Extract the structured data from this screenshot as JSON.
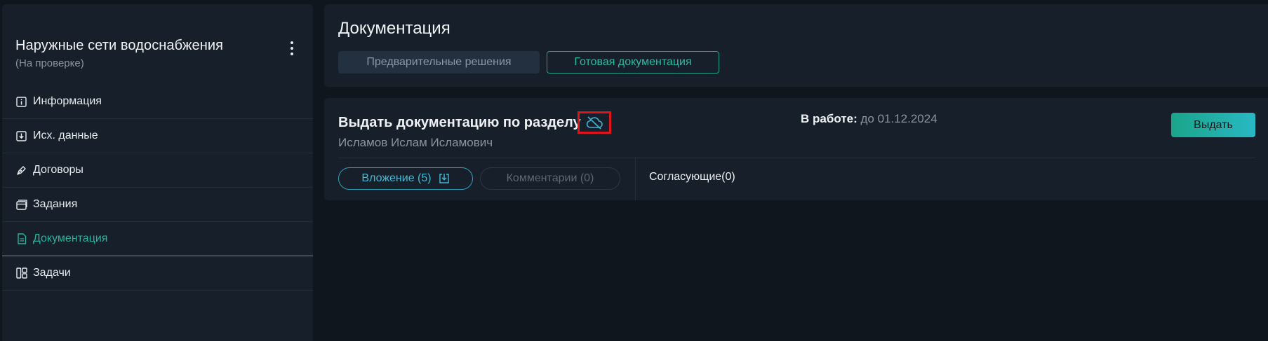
{
  "sidebar": {
    "project_title": "Наружные сети водоснабжения",
    "project_status": "(На проверке)",
    "items": [
      {
        "label": "Информация",
        "icon": "info-icon"
      },
      {
        "label": "Исх. данные",
        "icon": "download-box-icon"
      },
      {
        "label": "Договоры",
        "icon": "pen-icon"
      },
      {
        "label": "Задания",
        "icon": "cards-icon"
      },
      {
        "label": "Документация",
        "icon": "document-icon",
        "active": true
      },
      {
        "label": "Задачи",
        "icon": "layout-icon"
      }
    ]
  },
  "header": {
    "title": "Документация",
    "tabs": [
      {
        "label": "Предварительные решения",
        "active": false
      },
      {
        "label": "Готовая документация",
        "active": true
      }
    ]
  },
  "task": {
    "title": "Выдать документацию по разделу",
    "person": "Исламов Ислам Исламович",
    "status_label": "В работе:",
    "status_value": "до 01.12.2024",
    "issue_button": "Выдать",
    "attachments_label": "Вложение (5)",
    "comments_label": "Комментарии (0)",
    "approvers_label": "Согласующие(0)"
  },
  "colors": {
    "background": "#0f161d",
    "panel": "#17202a",
    "accent": "#27b39e",
    "highlight_box": "#e0141b"
  }
}
